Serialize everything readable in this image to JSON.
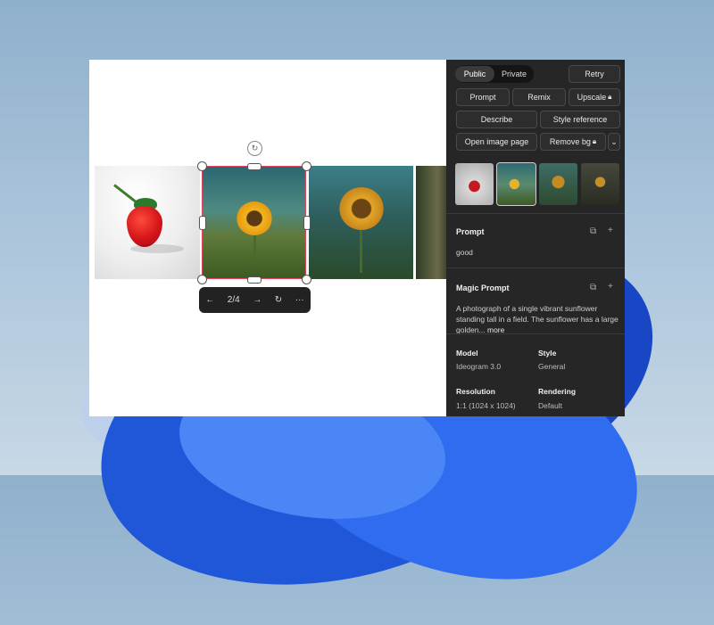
{
  "toolbar": {
    "prev_label": "←",
    "counter": "2/4",
    "next_label": "→",
    "refresh_label": "↻",
    "more_label": "···"
  },
  "panel": {
    "visibility": {
      "public": "Public",
      "private": "Private",
      "selected": "Public"
    },
    "buttons": {
      "retry": "Retry",
      "prompt": "Prompt",
      "remix": "Remix",
      "upscale": "Upscale",
      "describe": "Describe",
      "style_reference": "Style reference",
      "open_image_page": "Open image page",
      "remove_bg": "Remove bg",
      "dropdown": "⌄"
    },
    "prompt": {
      "title": "Prompt",
      "text": "good"
    },
    "magic_prompt": {
      "title": "Magic Prompt",
      "text": "A photograph of a single vibrant sunflower standing tall in a field. The sunflower has a large golden...",
      "more": "more"
    },
    "meta": {
      "model_label": "Model",
      "model_value": "Ideogram 3.0",
      "style_label": "Style",
      "style_value": "General",
      "resolution_label": "Resolution",
      "resolution_value": "1:1 (1024 x 1024)",
      "rendering_label": "Rendering",
      "rendering_value": "Default"
    }
  },
  "icons": {
    "copy": "copy-icon",
    "add": "plus-icon",
    "rotate": "rotate-icon",
    "lock": "lock-icon"
  },
  "colors": {
    "panel_bg": "#262626",
    "selection_border": "#e0455a",
    "desktop_bg": "#a9c3da"
  }
}
